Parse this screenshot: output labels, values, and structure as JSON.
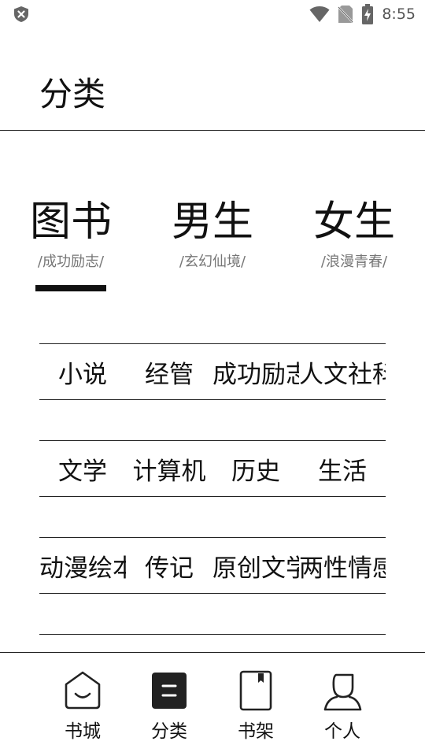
{
  "status_bar": {
    "time": "8:55",
    "icons": [
      "shield-icon",
      "wifi-icon",
      "no-sim-icon",
      "battery-charging-icon"
    ]
  },
  "header": {
    "title": "分类"
  },
  "tabs": [
    {
      "label": "图书",
      "sub": "/成功励志/",
      "selected": true
    },
    {
      "label": "男生",
      "sub": "/玄幻仙境/",
      "selected": false
    },
    {
      "label": "女生",
      "sub": "/浪漫青春/",
      "selected": false
    }
  ],
  "genres": {
    "rows": [
      [
        "小说",
        "经管",
        "成功励志",
        "人文社科"
      ],
      [
        "文学",
        "计算机",
        "历史",
        "生活"
      ],
      [
        "动漫绘本",
        "传记",
        "原创文学",
        "两性情感"
      ],
      [
        "",
        "",
        "",
        ""
      ]
    ]
  },
  "bottom_nav": {
    "items": [
      {
        "label": "书城",
        "icon": "home-icon",
        "active": false
      },
      {
        "label": "分类",
        "icon": "category-icon",
        "active": true
      },
      {
        "label": "书架",
        "icon": "bookshelf-icon",
        "active": false
      },
      {
        "label": "个人",
        "icon": "profile-icon",
        "active": false
      }
    ]
  },
  "colors": {
    "text": "#111111",
    "subtext": "#777777",
    "accent": "#111111",
    "background": "#ffffff"
  }
}
